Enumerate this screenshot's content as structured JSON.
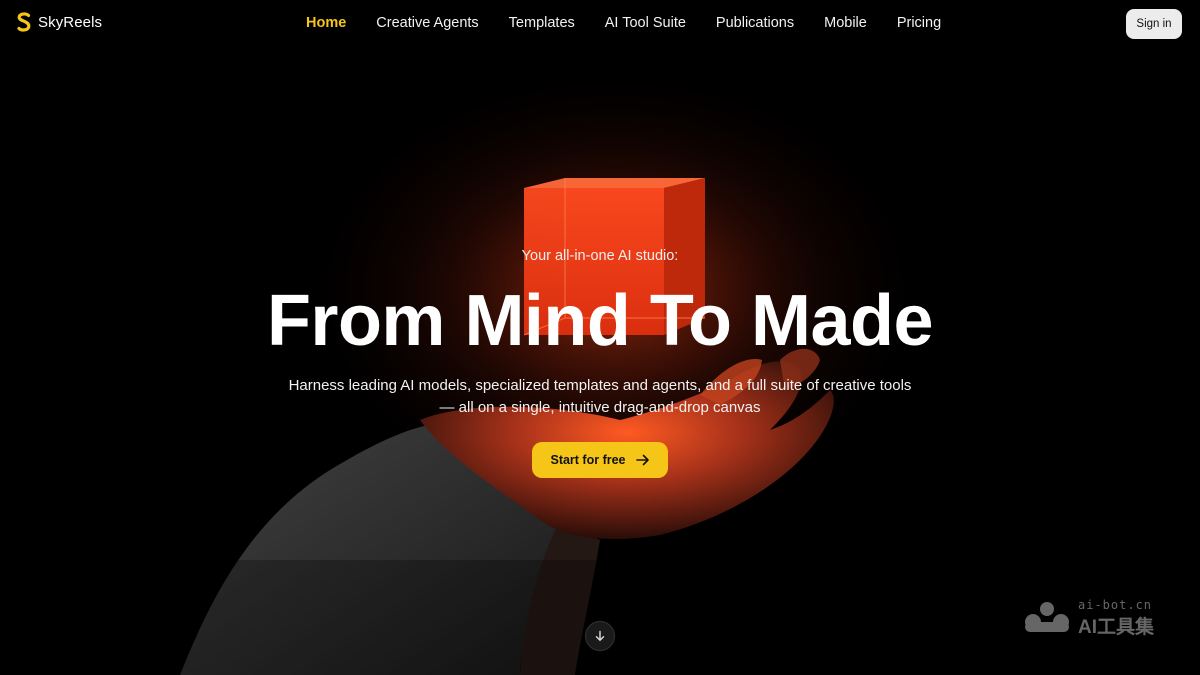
{
  "brand": {
    "name": "SkyReels",
    "accent": "#f5c518"
  },
  "nav": {
    "items": [
      {
        "label": "Home",
        "active": true
      },
      {
        "label": "Creative Agents",
        "active": false
      },
      {
        "label": "Templates",
        "active": false
      },
      {
        "label": "AI Tool Suite",
        "active": false
      },
      {
        "label": "Publications",
        "active": false
      },
      {
        "label": "Mobile",
        "active": false
      },
      {
        "label": "Pricing",
        "active": false
      }
    ],
    "signin_label": "Sign in"
  },
  "hero": {
    "eyebrow": "Your all-in-one AI studio:",
    "headline": "From Mind To Made",
    "subline_1": "Harness leading AI models, specialized templates and agents, and a full suite of creative tools",
    "subline_2": "— all on a single, intuitive drag-and-drop canvas",
    "cta_label": "Start for free",
    "cta_icon": "arrow-right-icon",
    "scroll_icon": "arrow-down-icon",
    "image": "glowing-cube-over-hand"
  },
  "watermark": {
    "line1": "ai-bot.cn",
    "line2": "AI工具集"
  }
}
